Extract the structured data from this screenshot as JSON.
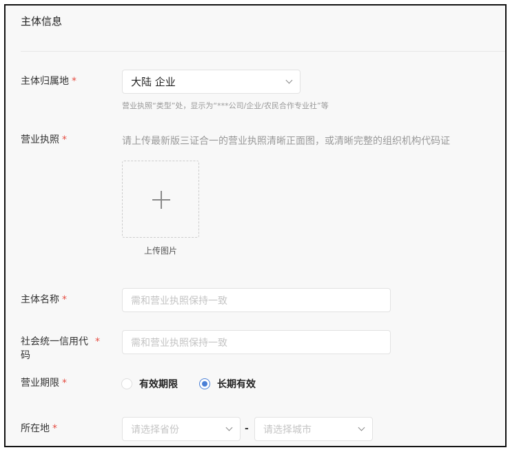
{
  "section_title": "主体信息",
  "required_mark": "*",
  "region": {
    "label": "主体归属地",
    "value": "大陆 企业",
    "hint": "营业执照“类型”处，显示为“***公司/企业/农民合作专业社”等"
  },
  "license": {
    "label": "营业执照",
    "hint": "请上传最新版三证合一的营业执照清晰正面图，或清晰完整的组织机构代码证",
    "upload_label": "上传图片"
  },
  "entity_name": {
    "label": "主体名称",
    "placeholder": "需和营业执照保持一致"
  },
  "credit_code": {
    "label_line1": "社会统一信用代",
    "label_line2": "码",
    "placeholder": "需和营业执照保持一致"
  },
  "term": {
    "label": "营业期限",
    "options": [
      {
        "label": "有效期限",
        "selected": false
      },
      {
        "label": "长期有效",
        "selected": true
      }
    ]
  },
  "location": {
    "label": "所在地",
    "province_placeholder": "请选择省份",
    "separator": "-",
    "city_placeholder": "请选择城市"
  }
}
